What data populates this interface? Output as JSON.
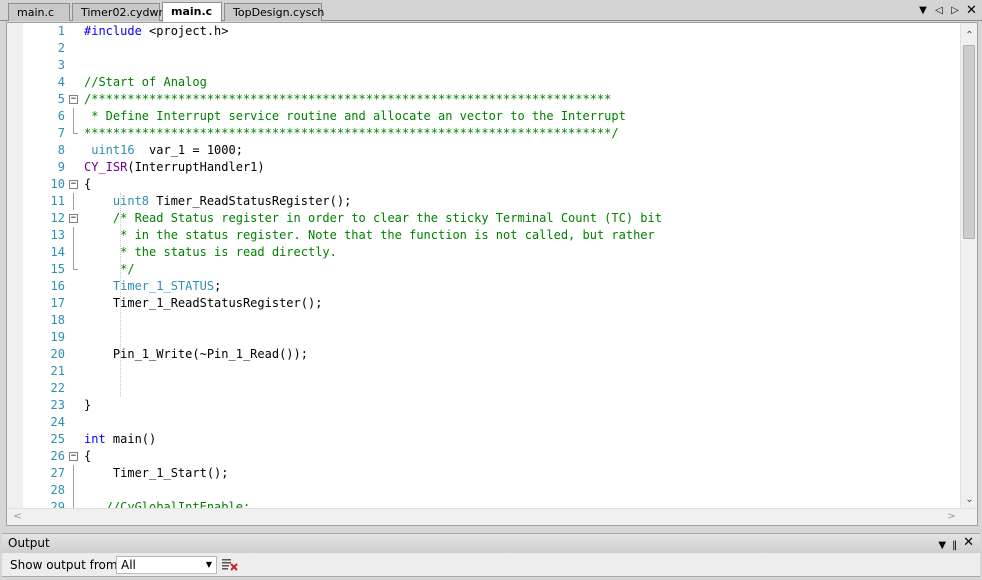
{
  "tabs": [
    {
      "label": "main.c",
      "active": false
    },
    {
      "label": "Timer02.cydwr",
      "active": false
    },
    {
      "label": "main.c",
      "active": true
    },
    {
      "label": "TopDesign.cysch",
      "active": false
    }
  ],
  "tab_controls": {
    "dropdown_icon": "chevron-down-icon",
    "prev_icon": "triangle-left-icon",
    "next_icon": "triangle-right-icon",
    "close_icon": "close-icon"
  },
  "code_lines": [
    {
      "n": "1",
      "fold": "",
      "segs": [
        {
          "c": "kw",
          "t": "#include"
        },
        {
          "c": "pl",
          "t": " <project.h>"
        }
      ]
    },
    {
      "n": "2",
      "fold": "",
      "segs": []
    },
    {
      "n": "3",
      "fold": "",
      "segs": []
    },
    {
      "n": "4",
      "fold": "",
      "segs": [
        {
          "c": "cm",
          "t": "//Start of Analog"
        }
      ]
    },
    {
      "n": "5",
      "fold": "minus",
      "segs": [
        {
          "c": "cm",
          "t": "/************************************************************************"
        }
      ]
    },
    {
      "n": "6",
      "fold": "",
      "segs": [
        {
          "c": "cm",
          "t": " * Define Interrupt service routine and allocate an vector to the Interrupt"
        }
      ]
    },
    {
      "n": "7",
      "fold": "end",
      "segs": [
        {
          "c": "cm",
          "t": "*************************************************************************/"
        }
      ]
    },
    {
      "n": "8",
      "fold": "",
      "segs": [
        {
          "c": "ty",
          "t": " uint16"
        },
        {
          "c": "pl",
          "t": "  var_1 = 1000;"
        }
      ]
    },
    {
      "n": "9",
      "fold": "",
      "segs": [
        {
          "c": "mc",
          "t": "CY_ISR"
        },
        {
          "c": "pl",
          "t": "(InterruptHandler1)"
        }
      ]
    },
    {
      "n": "10",
      "fold": "minus",
      "segs": [
        {
          "c": "pl",
          "t": "{"
        }
      ]
    },
    {
      "n": "11",
      "fold": "",
      "segs": [
        {
          "c": "pl",
          "t": "    "
        },
        {
          "c": "ty",
          "t": "uint8"
        },
        {
          "c": "pl",
          "t": " Timer_ReadStatusRegister();"
        }
      ]
    },
    {
      "n": "12",
      "fold": "minus",
      "segs": [
        {
          "c": "pl",
          "t": "    "
        },
        {
          "c": "cm",
          "t": "/* Read Status register in order to clear the sticky Terminal Count (TC) bit"
        }
      ]
    },
    {
      "n": "13",
      "fold": "",
      "segs": [
        {
          "c": "cm",
          "t": "     * in the status register. Note that the function is not called, but rather"
        }
      ]
    },
    {
      "n": "14",
      "fold": "",
      "segs": [
        {
          "c": "cm",
          "t": "     * the status is read directly."
        }
      ]
    },
    {
      "n": "15",
      "fold": "end",
      "segs": [
        {
          "c": "cm",
          "t": "     */"
        }
      ]
    },
    {
      "n": "16",
      "fold": "",
      "segs": [
        {
          "c": "pl",
          "t": "    "
        },
        {
          "c": "ty",
          "t": "Timer_1_STATUS"
        },
        {
          "c": "pl",
          "t": ";"
        }
      ]
    },
    {
      "n": "17",
      "fold": "",
      "segs": [
        {
          "c": "pl",
          "t": "    Timer_1_ReadStatusRegister();"
        }
      ]
    },
    {
      "n": "18",
      "fold": "",
      "segs": []
    },
    {
      "n": "19",
      "fold": "",
      "segs": []
    },
    {
      "n": "20",
      "fold": "",
      "segs": [
        {
          "c": "pl",
          "t": "    Pin_1_Write(~Pin_1_Read());"
        }
      ]
    },
    {
      "n": "21",
      "fold": "",
      "segs": []
    },
    {
      "n": "22",
      "fold": "",
      "segs": []
    },
    {
      "n": "23",
      "fold": "end",
      "segs": [
        {
          "c": "pl",
          "t": "}"
        }
      ]
    },
    {
      "n": "24",
      "fold": "",
      "segs": []
    },
    {
      "n": "25",
      "fold": "",
      "segs": [
        {
          "c": "kw",
          "t": "int"
        },
        {
          "c": "pl",
          "t": " main()"
        }
      ]
    },
    {
      "n": "26",
      "fold": "minus",
      "segs": [
        {
          "c": "pl",
          "t": "{"
        }
      ]
    },
    {
      "n": "27",
      "fold": "",
      "segs": [
        {
          "c": "pl",
          "t": "    Timer_1_Start();"
        }
      ]
    },
    {
      "n": "28",
      "fold": "",
      "segs": []
    },
    {
      "n": "29",
      "fold": "",
      "segs": [
        {
          "c": "cm",
          "t": "   //CyGlobalIntEnable;"
        }
      ]
    }
  ],
  "syntax_colors": {
    "kw": "#0000ff",
    "cm": "#008000",
    "ty": "#2b91af",
    "mc": "#6f008a",
    "pl": "#000000",
    "line_number": "#2b91af"
  },
  "output": {
    "title": "Output",
    "show_from_label": "Show output from:",
    "show_from_value": "All",
    "clear_icon": "clear-all-icon",
    "pin_icon": "pin-icon",
    "close_icon": "close-icon"
  }
}
